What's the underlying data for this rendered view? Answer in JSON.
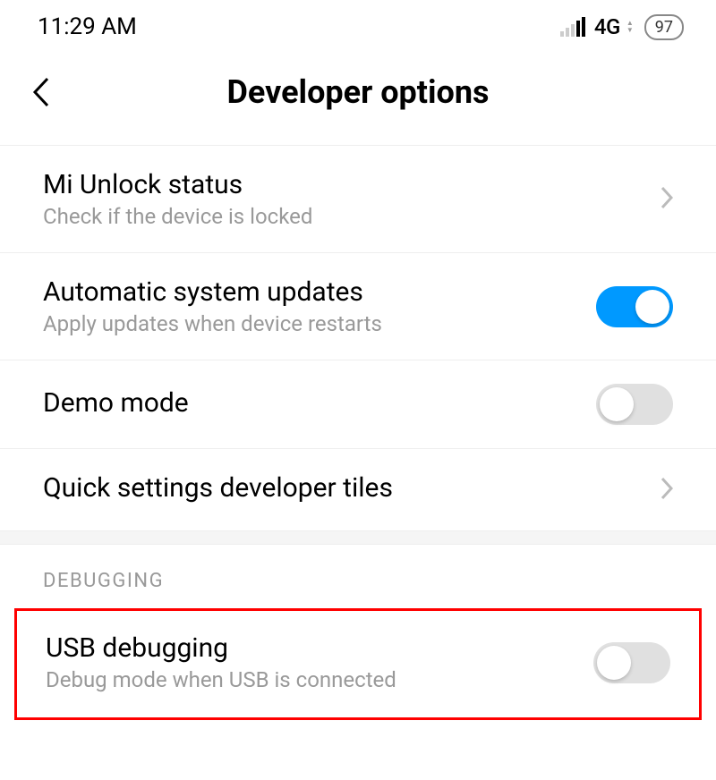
{
  "status": {
    "time": "11:29 AM",
    "network": "4G",
    "battery": "97"
  },
  "header": {
    "title": "Developer options"
  },
  "items": {
    "mi_unlock": {
      "title": "Mi Unlock status",
      "subtitle": "Check if the device is locked"
    },
    "auto_updates": {
      "title": "Automatic system updates",
      "subtitle": "Apply updates when device restarts",
      "on": true
    },
    "demo_mode": {
      "title": "Demo mode",
      "on": false
    },
    "quick_tiles": {
      "title": "Quick settings developer tiles"
    },
    "usb_debugging": {
      "title": "USB debugging",
      "subtitle": "Debug mode when USB is connected",
      "on": false
    }
  },
  "sections": {
    "debugging": "DEBUGGING"
  }
}
